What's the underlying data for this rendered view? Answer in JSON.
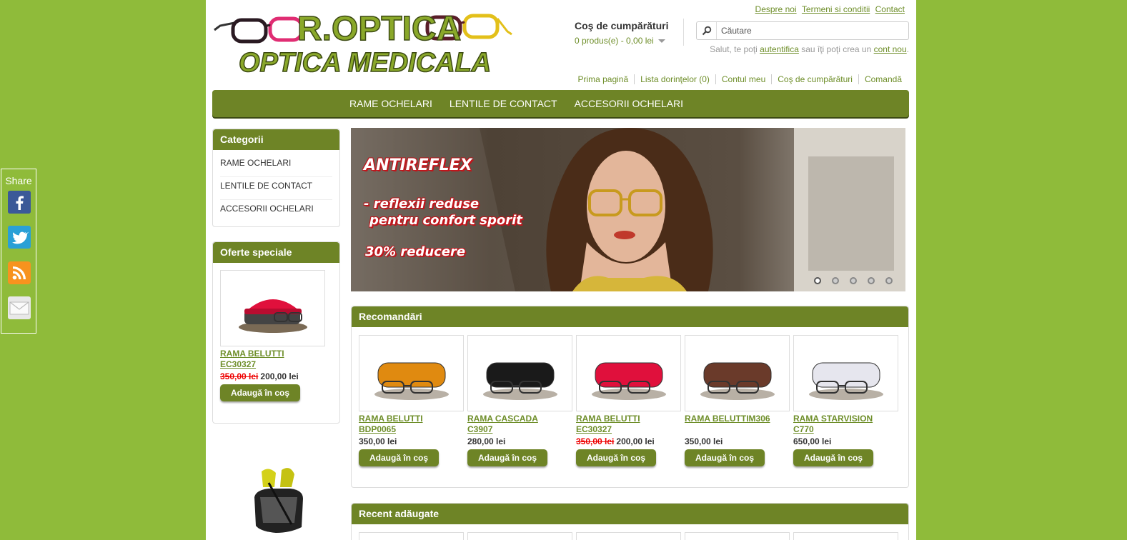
{
  "share": {
    "label": "Share",
    "buttons": [
      {
        "icon": "facebook-icon",
        "color": "#3b5998"
      },
      {
        "icon": "twitter-icon",
        "color": "#2aa0d6"
      },
      {
        "icon": "rss-icon",
        "color": "#f7931e"
      },
      {
        "icon": "email-icon",
        "color": "#e8e8e8"
      }
    ]
  },
  "logo": {
    "brand": "R.OPTICA",
    "tagline": "OPTICA MEDICALA"
  },
  "cart": {
    "title": "Coş de cumpărături",
    "summary": "0 produs(e) - 0,00 lei"
  },
  "top_links": [
    "Despre noi",
    "Termeni si conditii",
    "Contact"
  ],
  "search": {
    "placeholder": "Căutare"
  },
  "welcome": {
    "prefix": "Salut, te poţi ",
    "login": "autentifica",
    "middle": " sau îţi poţi crea un ",
    "register": "cont nou",
    "suffix": "."
  },
  "nav_links": [
    "Prima pagină",
    "Lista dorinţelor (0)",
    "Contul meu",
    "Coş de cumpărături",
    "Comandă"
  ],
  "menu": [
    "RAME OCHELARI",
    "LENTILE DE CONTACT",
    "ACCESORII OCHELARI"
  ],
  "categories": {
    "title": "Categorii",
    "items": [
      "RAME OCHELARI",
      "LENTILE DE CONTACT",
      "ACCESORII OCHELARI"
    ]
  },
  "specials": {
    "title": "Oferte speciale",
    "product": {
      "name_line1": "RAMA BELUTTI",
      "name_line2": "EC30327",
      "old_price": "350,00 lei",
      "price": "200,00 lei",
      "button": "Adaugă în coş"
    }
  },
  "slideshow": {
    "headline": "ANTIREFLEX",
    "line1": "- reflexii reduse",
    "line2": "pentru confort sporit",
    "line3": "30% reducere",
    "slides": 5,
    "active": 1
  },
  "recommended": {
    "title": "Recomandări",
    "products": [
      {
        "name_line1": "RAMA BELUTTI",
        "name_line2": "BDP0065",
        "old_price": "",
        "price": "350,00 lei",
        "button": "Adaugă în coş",
        "case_color": "#e08a10"
      },
      {
        "name_line1": "RAMA CASCADA",
        "name_line2": "C3907",
        "old_price": "",
        "price": "280,00 lei",
        "button": "Adaugă în coş",
        "case_color": "#1a1a1a"
      },
      {
        "name_line1": "RAMA BELUTTI",
        "name_line2": "EC30327",
        "old_price": "350,00 lei",
        "price": "200,00 lei",
        "button": "Adaugă în coş",
        "case_color": "#e0103c"
      },
      {
        "name_line1": "RAMA BELUTTIM306",
        "name_line2": "",
        "old_price": "",
        "price": "350,00 lei",
        "button": "Adaugă în coş",
        "case_color": "#6a3a2a"
      },
      {
        "name_line1": "RAMA STARVISION",
        "name_line2": "C770",
        "old_price": "",
        "price": "650,00 lei",
        "button": "Adaugă în coş",
        "case_color": "#e6e6ee"
      }
    ]
  },
  "recent": {
    "title": "Recent adăugate"
  },
  "colors": {
    "accent": "#6e8426",
    "link": "#6e8e29",
    "background": "#8fbb3a",
    "sale": "#e00000"
  }
}
